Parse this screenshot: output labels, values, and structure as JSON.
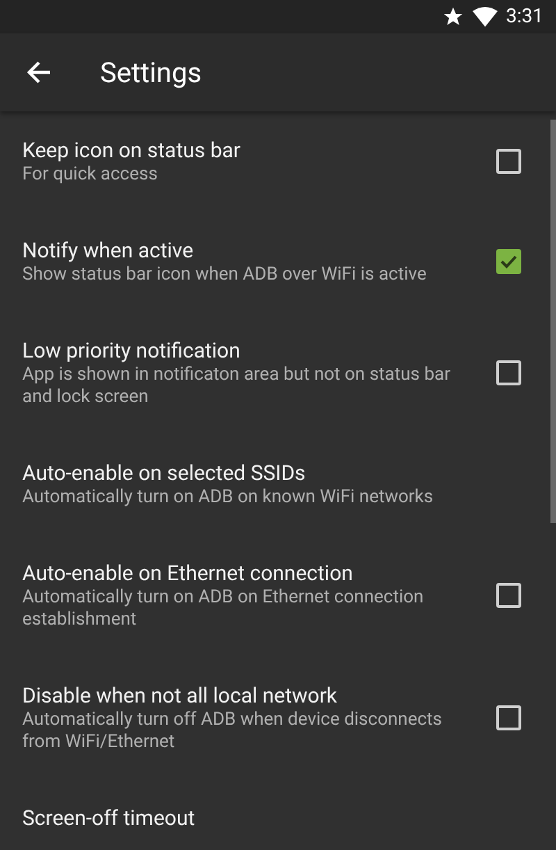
{
  "status_bar": {
    "time": "3:31"
  },
  "app_bar": {
    "title": "Settings"
  },
  "settings": [
    {
      "kind": "checkbox",
      "title": "Keep icon on status bar",
      "summary": "For quick access",
      "checked": false
    },
    {
      "kind": "checkbox",
      "title": "Notify when active",
      "summary": "Show status bar icon when ADB over WiFi is active",
      "checked": true
    },
    {
      "kind": "checkbox",
      "title": "Low priority notification",
      "summary": "App is shown in notificaton area but not on status bar and lock screen",
      "checked": false
    },
    {
      "kind": "plain",
      "title": "Auto-enable on selected SSIDs",
      "summary": "Automatically turn on ADB on known WiFi networks"
    },
    {
      "kind": "checkbox",
      "title": "Auto-enable on Ethernet connection",
      "summary": "Automatically turn on ADB on Ethernet connection establishment",
      "checked": false
    },
    {
      "kind": "checkbox",
      "title": "Disable when not all local network",
      "summary": "Automatically turn off ADB when device disconnects from WiFi/Ethernet",
      "checked": false
    },
    {
      "kind": "plain",
      "title": "Screen-off timeout"
    }
  ]
}
